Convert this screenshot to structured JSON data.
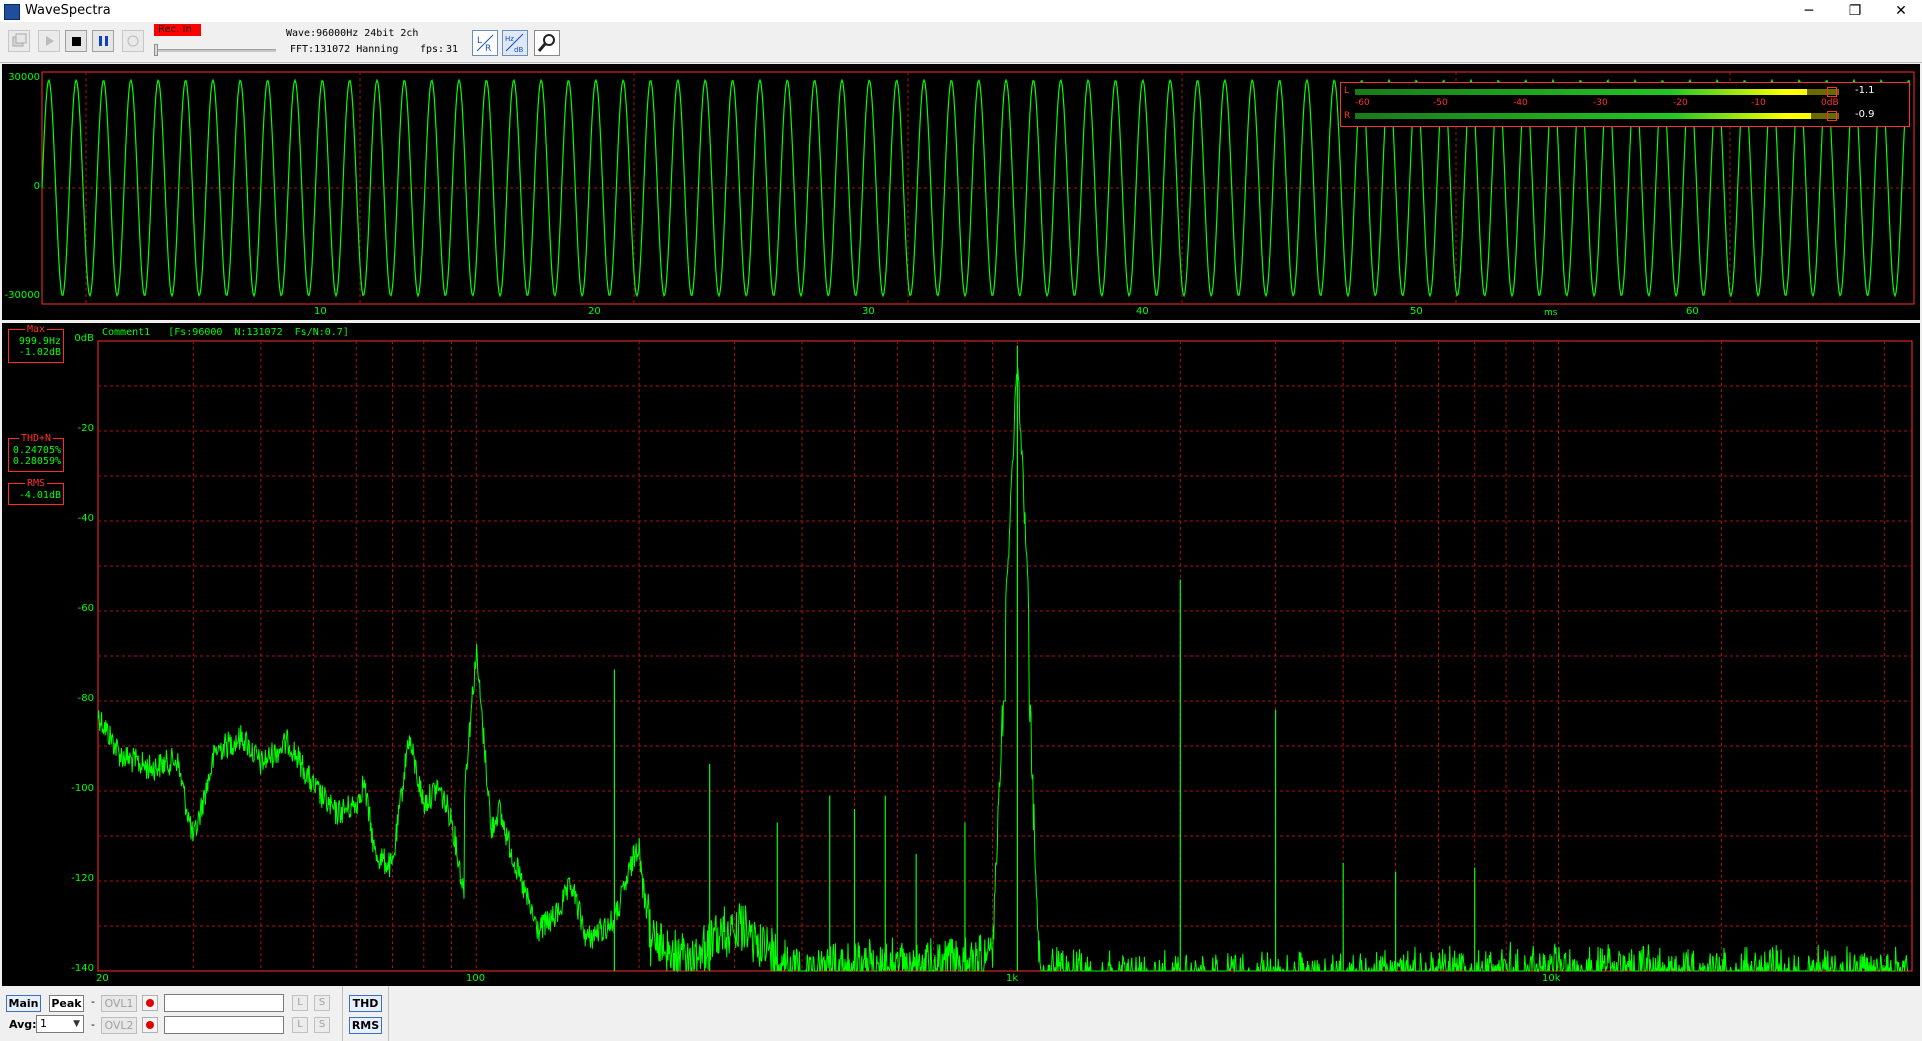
{
  "app": {
    "title": "WaveSpectra",
    "window_buttons": [
      "─",
      "❐",
      "✕"
    ]
  },
  "toolbar": {
    "rec_label": "Rec. In",
    "wave_info": "Wave:96000Hz 24bit 2ch",
    "fft_info": "FFT:131072 Hanning",
    "fps_label": "fps:",
    "fps_value": "31",
    "icons": [
      "open-icon",
      "play-icon",
      "stop-icon",
      "pause-icon",
      "record-icon",
      "lr-icon",
      "hz-db-icon",
      "settings-icon"
    ]
  },
  "scope": {
    "y_ticks": [
      "30000",
      "0",
      "-30000"
    ],
    "x_ticks": [
      "10",
      "20",
      "30",
      "40",
      "50",
      "60"
    ],
    "x_unit": "ms",
    "meter": {
      "L_label": "L",
      "R_label": "R",
      "scale": [
        "-60",
        "-50",
        "-40",
        "-30",
        "-20",
        "-10",
        "0dB"
      ],
      "L_value": "-1.1",
      "R_value": "-0.9"
    }
  },
  "spectrum": {
    "comment": "Comment1   [Fs:96000  N:131072  Fs/N:0.7]",
    "y_ticks": [
      "0dB",
      "-20",
      "-40",
      "-60",
      "-80",
      "-100",
      "-120",
      "-140"
    ],
    "x_ticks": [
      "20",
      "100",
      "1k",
      "10k"
    ],
    "max_box": {
      "title": "Max",
      "freq": "999.9Hz",
      "level": "-1.02dB"
    },
    "thd_box": {
      "title": "THD+N",
      "v1": "0.24705%",
      "v2": "0.28059%"
    },
    "rms_box": {
      "title": "RMS",
      "value": "-4.01dB"
    }
  },
  "bottom": {
    "main": "Main",
    "peak": "Peak",
    "avg_label": "Avg:",
    "avg_value": "1",
    "ovl1": "OVL1",
    "ovl2": "OVL2",
    "L": "L",
    "S": "S",
    "thd": "THD",
    "rms": "RMS",
    "dash": "-"
  },
  "colors": {
    "trace": "#00ff00",
    "grid": "#b01010",
    "frame": "#ff2b2b",
    "meter_bar": "#ffff00"
  }
}
